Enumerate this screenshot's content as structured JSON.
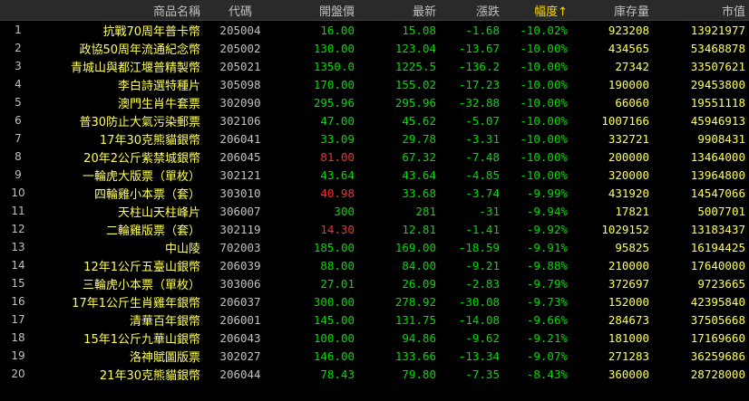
{
  "columns": {
    "name": "商品名稱",
    "code": "代碼",
    "open": "開盤價",
    "latest": "最新",
    "change": "漲跌",
    "pct": "幅度↑",
    "stock": "庫存量",
    "mcap": "市值"
  },
  "colors": {
    "up": "#ff2a2a",
    "down": "#00dd00",
    "name": "#ffff55",
    "neutral": "#c0c0c0"
  },
  "rows": [
    {
      "idx": "1",
      "name": "抗戰70周年普卡幣",
      "code": "205004",
      "open": "16.00",
      "open_color": "down",
      "latest": "15.08",
      "change": "-1.68",
      "pct": "-10.02%",
      "stock": "923208",
      "mcap": "13921977"
    },
    {
      "idx": "2",
      "name": "政協50周年流通紀念幣",
      "code": "205002",
      "open": "130.00",
      "open_color": "down",
      "latest": "123.04",
      "change": "-13.67",
      "pct": "-10.00%",
      "stock": "434565",
      "mcap": "53468878"
    },
    {
      "idx": "3",
      "name": "青城山與都江堰普精製幣",
      "code": "205021",
      "open": "1350.0",
      "open_color": "down",
      "latest": "1225.5",
      "change": "-136.2",
      "pct": "-10.00%",
      "stock": "27342",
      "mcap": "33507621"
    },
    {
      "idx": "4",
      "name": "李白詩選特種片",
      "code": "305098",
      "open": "170.00",
      "open_color": "down",
      "latest": "155.02",
      "change": "-17.23",
      "pct": "-10.00%",
      "stock": "190000",
      "mcap": "29453800"
    },
    {
      "idx": "5",
      "name": "澳門生肖牛套票",
      "code": "302090",
      "open": "295.96",
      "open_color": "down",
      "latest": "295.96",
      "change": "-32.88",
      "pct": "-10.00%",
      "stock": "66060",
      "mcap": "19551118"
    },
    {
      "idx": "6",
      "name": "普30防止大氣污染郵票",
      "code": "302106",
      "open": "47.00",
      "open_color": "down",
      "latest": "45.62",
      "change": "-5.07",
      "pct": "-10.00%",
      "stock": "1007166",
      "mcap": "45946913"
    },
    {
      "idx": "7",
      "name": "17年30克熊貓銀幣",
      "code": "206041",
      "open": "33.09",
      "open_color": "down",
      "latest": "29.78",
      "change": "-3.31",
      "pct": "-10.00%",
      "stock": "332721",
      "mcap": "9908431"
    },
    {
      "idx": "8",
      "name": "20年2公斤紫禁城銀幣",
      "code": "206045",
      "open": "81.00",
      "open_color": "up",
      "latest": "67.32",
      "change": "-7.48",
      "pct": "-10.00%",
      "stock": "200000",
      "mcap": "13464000"
    },
    {
      "idx": "9",
      "name": "一輪虎大版票（單枚）",
      "code": "302121",
      "open": "43.64",
      "open_color": "down",
      "latest": "43.64",
      "change": "-4.85",
      "pct": "-10.00%",
      "stock": "320000",
      "mcap": "13964800"
    },
    {
      "idx": "10",
      "name": "四輪雞小本票（套）",
      "code": "303010",
      "open": "40.98",
      "open_color": "up",
      "latest": "33.68",
      "change": "-3.74",
      "pct": "-9.99%",
      "stock": "431920",
      "mcap": "14547066"
    },
    {
      "idx": "11",
      "name": "天柱山天柱峰片",
      "code": "306007",
      "open": "300",
      "open_color": "down",
      "latest": "281",
      "change": "-31",
      "pct": "-9.94%",
      "stock": "17821",
      "mcap": "5007701"
    },
    {
      "idx": "12",
      "name": "二輪雞版票（套）",
      "code": "302119",
      "open": "14.30",
      "open_color": "up",
      "latest": "12.81",
      "change": "-1.41",
      "pct": "-9.92%",
      "stock": "1029152",
      "mcap": "13183437"
    },
    {
      "idx": "13",
      "name": "中山陵",
      "code": "702003",
      "open": "185.00",
      "open_color": "down",
      "latest": "169.00",
      "change": "-18.59",
      "pct": "-9.91%",
      "stock": "95825",
      "mcap": "16194425"
    },
    {
      "idx": "14",
      "name": "12年1公斤五臺山銀幣",
      "code": "206039",
      "open": "88.00",
      "open_color": "down",
      "latest": "84.00",
      "change": "-9.21",
      "pct": "-9.88%",
      "stock": "210000",
      "mcap": "17640000"
    },
    {
      "idx": "15",
      "name": "三輪虎小本票（單枚）",
      "code": "303006",
      "open": "27.01",
      "open_color": "down",
      "latest": "26.09",
      "change": "-2.83",
      "pct": "-9.79%",
      "stock": "372697",
      "mcap": "9723665"
    },
    {
      "idx": "16",
      "name": "17年1公斤生肖雞年銀幣",
      "code": "206037",
      "open": "300.00",
      "open_color": "down",
      "latest": "278.92",
      "change": "-30.08",
      "pct": "-9.73%",
      "stock": "152000",
      "mcap": "42395840"
    },
    {
      "idx": "17",
      "name": "清華百年銀幣",
      "code": "206001",
      "open": "145.00",
      "open_color": "down",
      "latest": "131.75",
      "change": "-14.08",
      "pct": "-9.66%",
      "stock": "284673",
      "mcap": "37505668"
    },
    {
      "idx": "18",
      "name": "15年1公斤九華山銀幣",
      "code": "206043",
      "open": "100.00",
      "open_color": "down",
      "latest": "94.86",
      "change": "-9.62",
      "pct": "-9.21%",
      "stock": "181000",
      "mcap": "17169660"
    },
    {
      "idx": "19",
      "name": "洛神賦圖版票",
      "code": "302027",
      "open": "146.00",
      "open_color": "down",
      "latest": "133.66",
      "change": "-13.34",
      "pct": "-9.07%",
      "stock": "271283",
      "mcap": "36259686"
    },
    {
      "idx": "20",
      "name": "21年30克熊貓銀幣",
      "code": "206044",
      "open": "78.43",
      "open_color": "down",
      "latest": "79.80",
      "change": "-7.35",
      "pct": "-8.43%",
      "stock": "360000",
      "mcap": "28728000"
    }
  ]
}
